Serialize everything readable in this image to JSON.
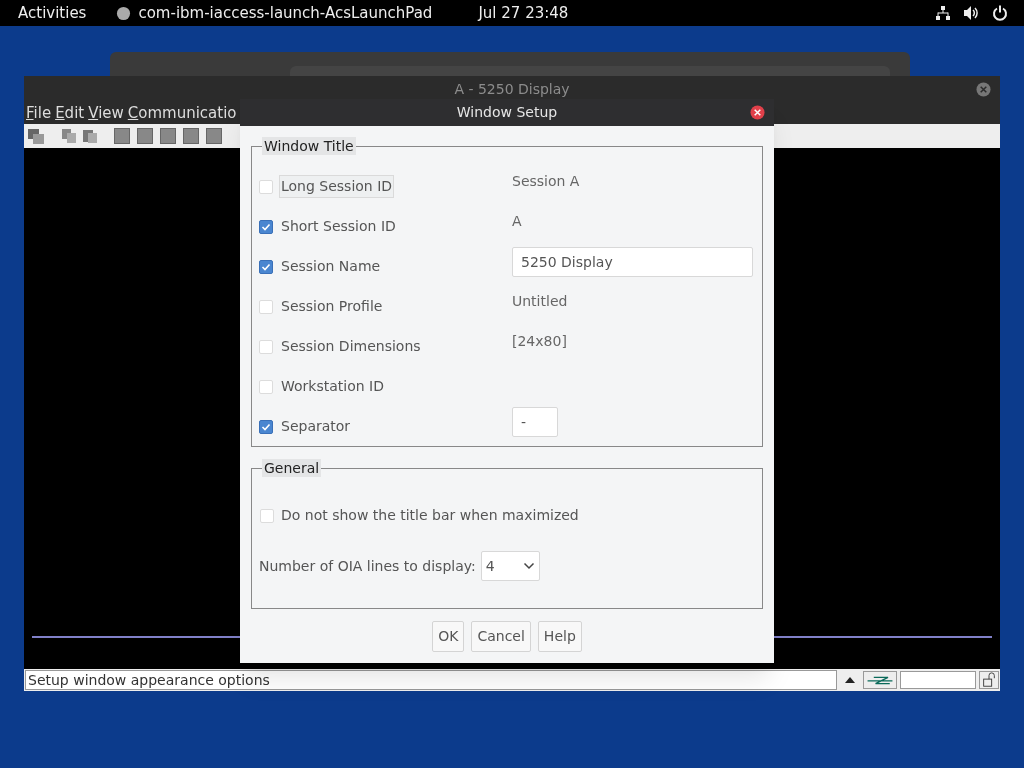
{
  "top_bar": {
    "activities": "Activities",
    "app_name": "com-ibm-iaccess-launch-AcsLaunchPad",
    "clock": "Jul 27  23:48"
  },
  "main_window": {
    "title": "A - 5250 Display",
    "menu": [
      "File",
      "Edit",
      "View",
      "Communicatio"
    ],
    "status_text": "Setup window appearance options"
  },
  "dialog": {
    "title": "Window Setup",
    "window_title_group": {
      "legend": "Window Title",
      "options": [
        {
          "label": "Long Session ID",
          "checked": false,
          "focused": true,
          "kind": "text",
          "value": "Session A"
        },
        {
          "label": "Short Session ID",
          "checked": true,
          "focused": false,
          "kind": "text",
          "value": "A"
        },
        {
          "label": "Session Name",
          "checked": true,
          "focused": false,
          "kind": "field",
          "value": "5250 Display"
        },
        {
          "label": "Session Profile",
          "checked": false,
          "focused": false,
          "kind": "text",
          "value": "Untitled"
        },
        {
          "label": "Session Dimensions",
          "checked": false,
          "focused": false,
          "kind": "text",
          "value": "[24x80]"
        },
        {
          "label": "Workstation ID",
          "checked": false,
          "focused": false,
          "kind": "none"
        },
        {
          "label": "Separator",
          "checked": true,
          "focused": false,
          "kind": "small_field",
          "value": "-"
        }
      ]
    },
    "general_group": {
      "legend": "General",
      "hide_title_bar": {
        "label": "Do not show the title bar when maximized",
        "checked": false
      },
      "oia_label": "Number of OIA lines to display:",
      "oia_value": "4"
    },
    "buttons": [
      "OK",
      "Cancel",
      "Help"
    ]
  }
}
